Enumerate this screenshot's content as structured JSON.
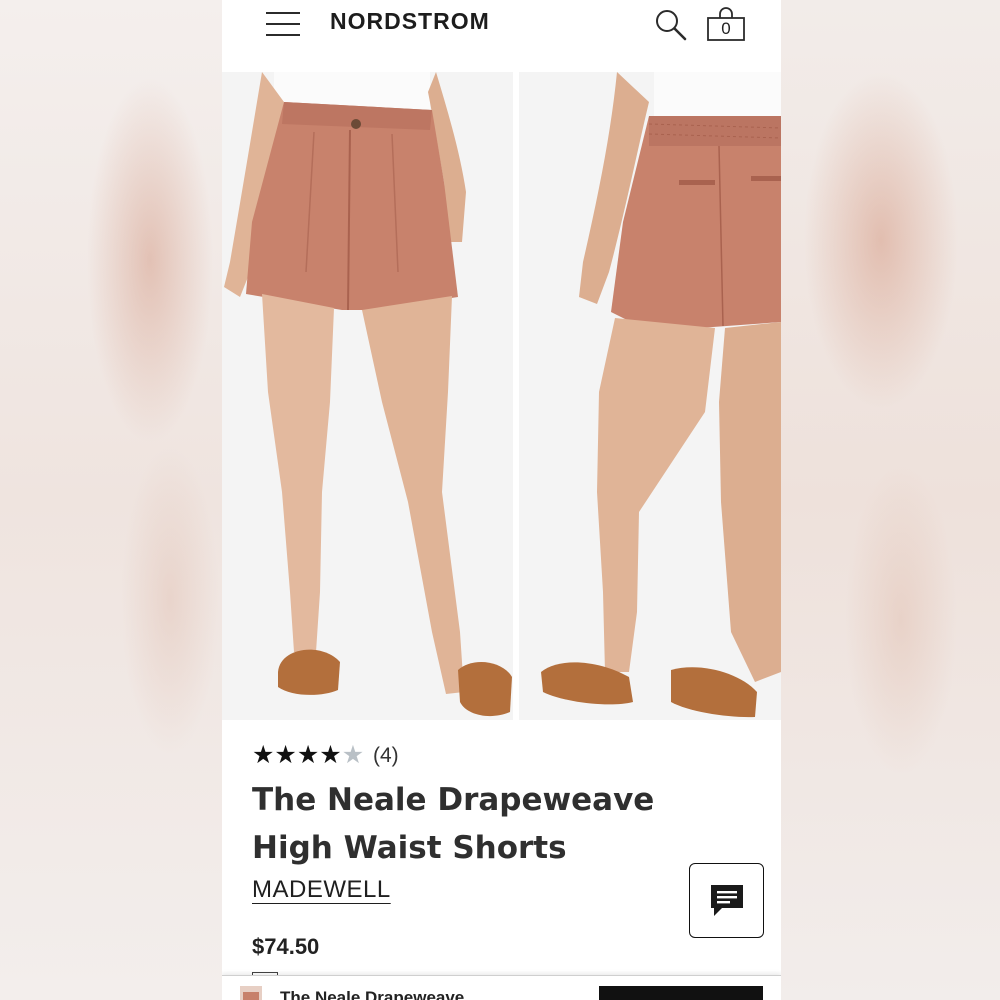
{
  "header": {
    "logo": "NORDSTROM",
    "bag_count": "0",
    "icons": [
      "menu-icon",
      "search-icon",
      "shopping-bag-icon"
    ]
  },
  "product": {
    "rating": 4,
    "rating_max": 5,
    "review_count": "(4)",
    "title": "The Neale Drapeweave High Waist Shorts",
    "brand": "MADEWELL",
    "price": "$74.50",
    "images": [
      "front-view-photo",
      "back-view-photo"
    ]
  },
  "sticky_bar": {
    "title": "The Neale Drapeweave"
  },
  "chat": {
    "icon": "chat-icon"
  },
  "colors": {
    "shorts": "#c8826c",
    "sandal": "#b36f3c",
    "skin": "#e2b89d",
    "text": "#2f2f2f"
  }
}
